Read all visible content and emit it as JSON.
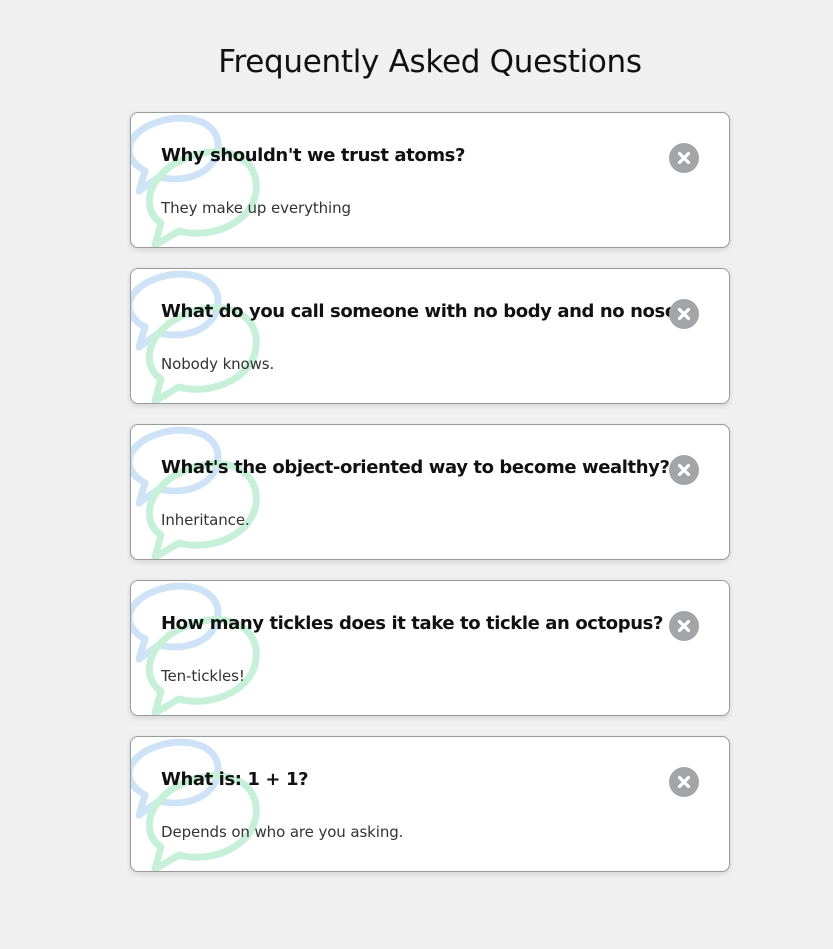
{
  "page": {
    "title": "Frequently Asked Questions"
  },
  "colors": {
    "background": "#f0f0f0",
    "card": "#ffffff",
    "bubble_blue": "#cfe3f7",
    "bubble_green": "#c7f0d8",
    "close_button": "#a3a5a8"
  },
  "icons": {
    "bubble": "chat-bubbles-icon",
    "close": "close-icon"
  },
  "faqs": [
    {
      "question": "Why shouldn't we trust atoms?",
      "answer": "They make up everything"
    },
    {
      "question": "What do you call someone with no body and no nose?",
      "answer": "Nobody knows."
    },
    {
      "question": "What's the object-oriented way to become wealthy?",
      "answer": "Inheritance."
    },
    {
      "question": "How many tickles does it take to tickle an octopus?",
      "answer": "Ten-tickles!"
    },
    {
      "question": "What is: 1 + 1?",
      "answer": "Depends on who are you asking."
    }
  ]
}
